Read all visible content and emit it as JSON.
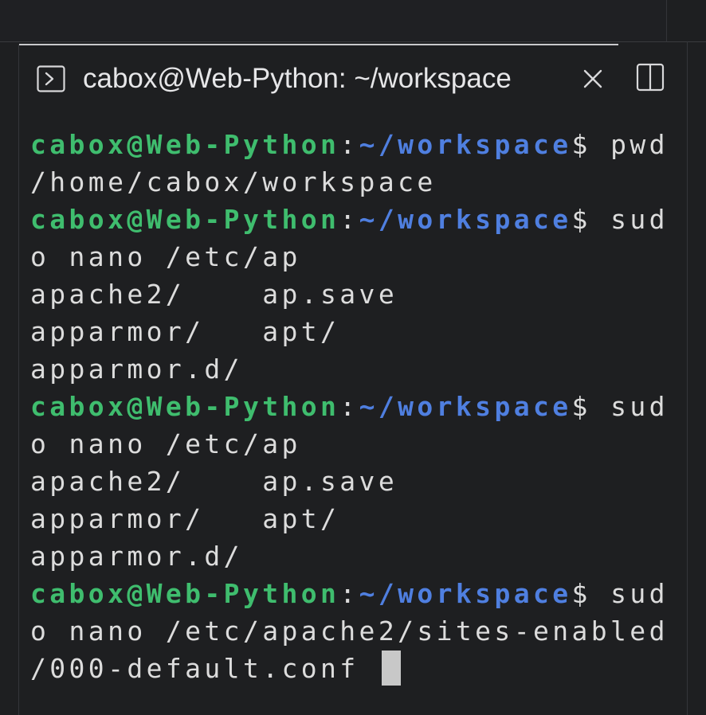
{
  "tab": {
    "title": "cabox@Web-Python: ~/workspace",
    "icon": "terminal-icon",
    "close_icon": "close-icon",
    "split_icon": "split-editor-icon"
  },
  "colors": {
    "background": "#1e1f21",
    "user_host": "#3fbd6e",
    "path": "#4f7fe0",
    "text": "#dcdcdc",
    "cursor": "#c8c8c8"
  },
  "terminal": {
    "lines": [
      {
        "user": "cabox@Web-Python",
        "sep": ":",
        "path": "~/workspace",
        "dollar": "$",
        "text": " pwd"
      },
      {
        "text": "/home/cabox/workspace"
      },
      {
        "user": "cabox@Web-Python",
        "sep": ":",
        "path": "~/workspace",
        "dollar": "$",
        "text": " sud"
      },
      {
        "text": "o nano /etc/ap"
      },
      {
        "text": "apache2/    ap.save"
      },
      {
        "text": "apparmor/   apt/"
      },
      {
        "text": "apparmor.d/"
      },
      {
        "user": "cabox@Web-Python",
        "sep": ":",
        "path": "~/workspace",
        "dollar": "$",
        "text": " sud"
      },
      {
        "text": "o nano /etc/ap"
      },
      {
        "text": "apache2/    ap.save"
      },
      {
        "text": "apparmor/   apt/"
      },
      {
        "text": "apparmor.d/"
      },
      {
        "user": "cabox@Web-Python",
        "sep": ":",
        "path": "~/workspace",
        "dollar": "$",
        "text": " sud"
      },
      {
        "text": "o nano /etc/apache2/sites-enabled"
      },
      {
        "text": "/000-default.conf "
      }
    ]
  }
}
